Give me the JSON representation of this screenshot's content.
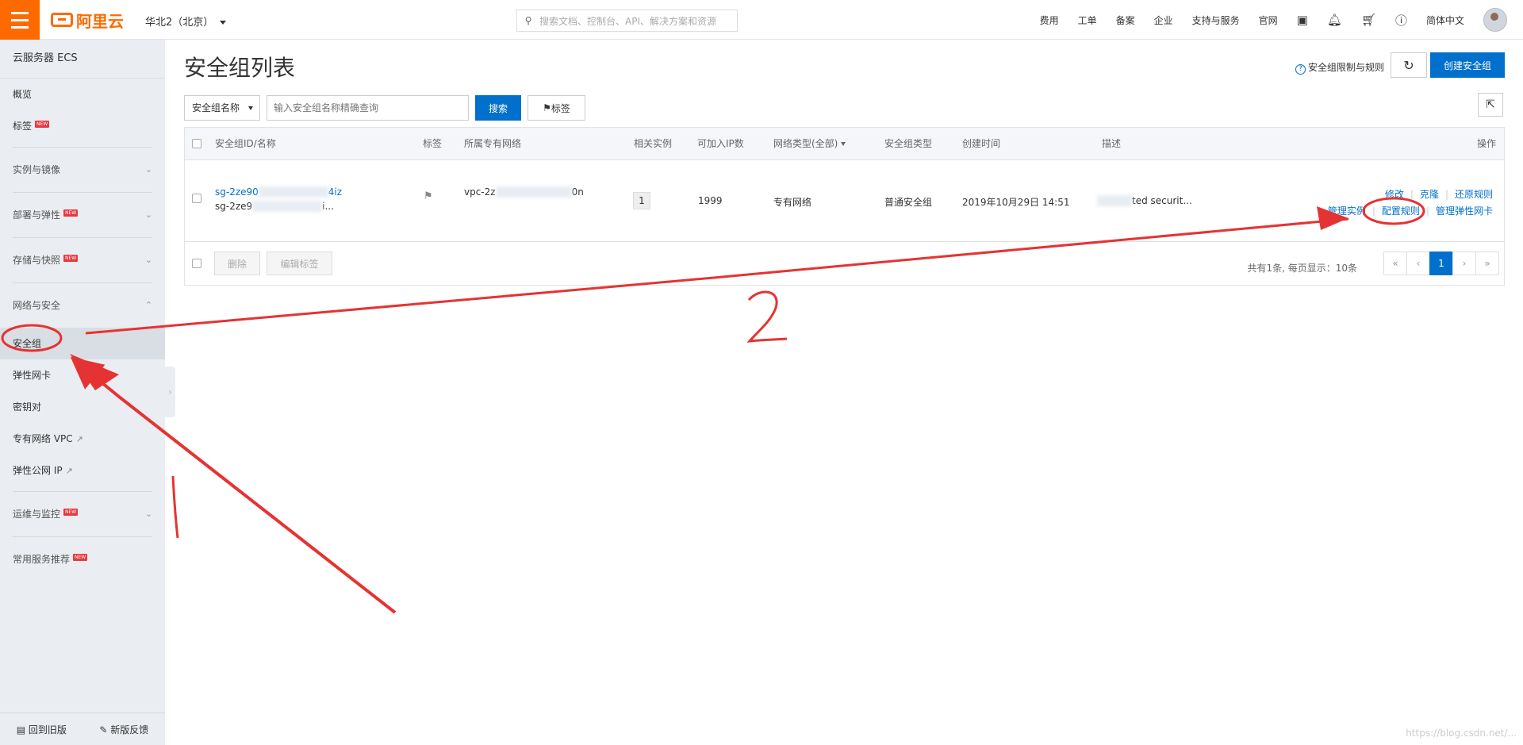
{
  "topbar": {
    "logo_text": "阿里云",
    "region": "华北2（北京）",
    "search_placeholder": "搜索文档、控制台、API、解决方案和资源",
    "nav": [
      "费用",
      "工单",
      "备案",
      "企业",
      "支持与服务",
      "官网"
    ],
    "language": "简体中文",
    "icons": [
      "terminal-icon",
      "bell-icon",
      "cart-icon",
      "help-icon"
    ]
  },
  "sidebar": {
    "product": "云服务器 ECS",
    "overview": "概览",
    "tags": "标签",
    "new_badge": "NEW",
    "groups": {
      "instances": "实例与镜像",
      "deploy": "部署与弹性",
      "storage": "存储与快照",
      "network": "网络与安全",
      "ops": "运维与监控",
      "common": "常用服务推荐"
    },
    "network_items": {
      "security_group": "安全组",
      "eni": "弹性网卡",
      "keypair": "密钥对",
      "vpc": "专有网络 VPC",
      "eip": "弹性公网 IP"
    },
    "back_old": "回到旧版",
    "feedback": "新版反馈"
  },
  "page": {
    "title": "安全组列表",
    "limit_link": "安全组限制与规则",
    "create_button": "创建安全组",
    "search_select": "安全组名称",
    "search_input_placeholder": "输入安全组名称精确查询",
    "search_button": "搜索",
    "tag_button": "标签"
  },
  "table": {
    "headers": {
      "id_name": "安全组ID/名称",
      "tag": "标签",
      "vpc": "所属专有网络",
      "instances": "相关实例",
      "ip_count": "可加入IP数",
      "net_type": "网络类型(全部)",
      "sg_type": "安全组类型",
      "created": "创建时间",
      "desc": "描述",
      "ops": "操作"
    },
    "row": {
      "id_prefix": "sg-2ze90",
      "id_suffix": "4iz",
      "name_prefix": "sg-2ze9",
      "name_suffix": "i...",
      "vpc_prefix": "vpc-2z",
      "vpc_suffix": "0n",
      "instances": "1",
      "ip_count": "1999",
      "net_type": "专有网络",
      "sg_type": "普通安全组",
      "created": "2019年10月29日 14:51",
      "desc_suffix": "ted securit...",
      "ops_row1": [
        "修改",
        "克隆",
        "还原规则"
      ],
      "ops_row2": [
        "管理实例",
        "配置规则",
        "管理弹性网卡"
      ]
    },
    "footer": {
      "delete": "删除",
      "edit_tags": "编辑标签",
      "page_info": "共有1条, 每页显示：10条",
      "pager": [
        "«",
        "‹",
        "1",
        "›",
        "»"
      ]
    }
  },
  "annotations": {
    "label_1": "1",
    "label_2": "2"
  },
  "watermark": "https://blog.csdn.net/..."
}
